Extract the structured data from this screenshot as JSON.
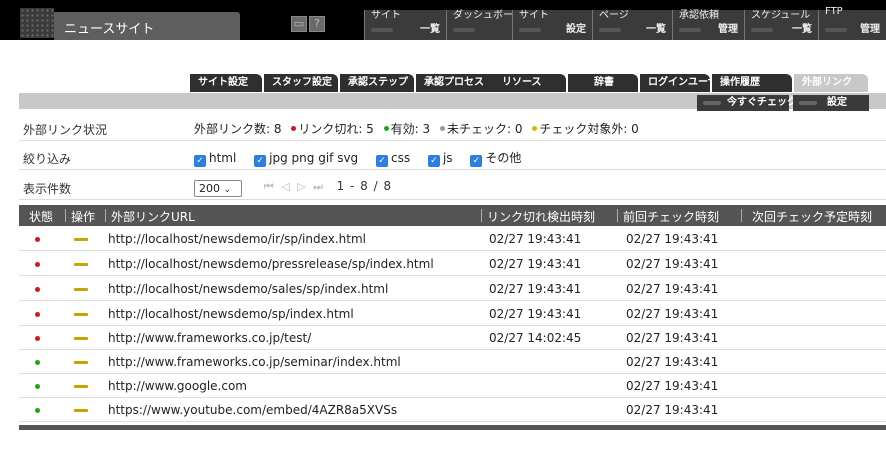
{
  "app": {
    "site_name": "ニュースサイト",
    "help_label": "?"
  },
  "topnav": [
    {
      "line1": "サイト",
      "line2": "一覧"
    },
    {
      "line1": "ダッシュボード",
      "line2": ""
    },
    {
      "line1": "サイト",
      "line2": "設定"
    },
    {
      "line1": "ページ",
      "line2": "一覧"
    },
    {
      "line1": "承認依頼",
      "line2": "管理"
    },
    {
      "line1": "スケジュール",
      "line2": "一覧"
    },
    {
      "line1": "FTP",
      "line2": "管理"
    }
  ],
  "tabs": [
    "サイト設定",
    "スタッフ設定",
    "承認ステップ",
    "承認プロセス",
    "リソース",
    "辞書",
    "ログインユーザ",
    "操作履歴",
    "外部リンク"
  ],
  "active_tab": "外部リンク",
  "actions": {
    "check_now": "今すぐチェック",
    "settings": "設定"
  },
  "status_row": {
    "label": "外部リンク状況",
    "total": "外部リンク数: 8",
    "broken": "リンク切れ: 5",
    "valid": "有効: 3",
    "unchecked": "未チェック: 0",
    "excluded": "チェック対象外: 0"
  },
  "filter_row": {
    "label": "絞り込み",
    "options": [
      "html",
      "jpg png gif svg",
      "css",
      "js",
      "その他"
    ]
  },
  "display_row": {
    "label": "表示件数",
    "per_page": "200",
    "page_info": "1 - 8 / 8"
  },
  "table": {
    "headers": [
      "状態",
      "操作",
      "外部リンクURL",
      "リンク切れ検出時刻",
      "前回チェック時刻",
      "次回チェック予定時刻"
    ],
    "rows": [
      {
        "status": "broken",
        "url": "http://localhost/newsdemo/ir/sp/index.html",
        "broken_at": "02/27 19:43:41",
        "prev_check": "02/27 19:43:41"
      },
      {
        "status": "broken",
        "url": "http://localhost/newsdemo/pressrelease/sp/index.html",
        "broken_at": "02/27 19:43:41",
        "prev_check": "02/27 19:43:41"
      },
      {
        "status": "broken",
        "url": "http://localhost/newsdemo/sales/sp/index.html",
        "broken_at": "02/27 19:43:41",
        "prev_check": "02/27 19:43:41"
      },
      {
        "status": "broken",
        "url": "http://localhost/newsdemo/sp/index.html",
        "broken_at": "02/27 19:43:41",
        "prev_check": "02/27 19:43:41"
      },
      {
        "status": "broken",
        "url": "http://www.frameworks.co.jp/test/",
        "broken_at": "02/27 14:02:45",
        "prev_check": "02/27 19:43:41"
      },
      {
        "status": "valid",
        "url": "http://www.frameworks.co.jp/seminar/index.html",
        "broken_at": "",
        "prev_check": "02/27 19:43:41"
      },
      {
        "status": "valid",
        "url": "http://www.google.com",
        "broken_at": "",
        "prev_check": "02/27 19:43:41"
      },
      {
        "status": "valid",
        "url": "https://www.youtube.com/embed/4AZR8a5XVSs",
        "broken_at": "",
        "prev_check": "02/27 19:43:41"
      }
    ]
  },
  "colors": {
    "broken": "#d01818",
    "valid": "#1aa81a",
    "unchecked": "#999999",
    "excluded": "#d4b800",
    "checkbox": "#2b7fde",
    "operation": "#c8a400"
  },
  "icons": {
    "logo": "grid-logo-icon",
    "screen": "screen-icon",
    "operation": "edit-bar-icon"
  }
}
